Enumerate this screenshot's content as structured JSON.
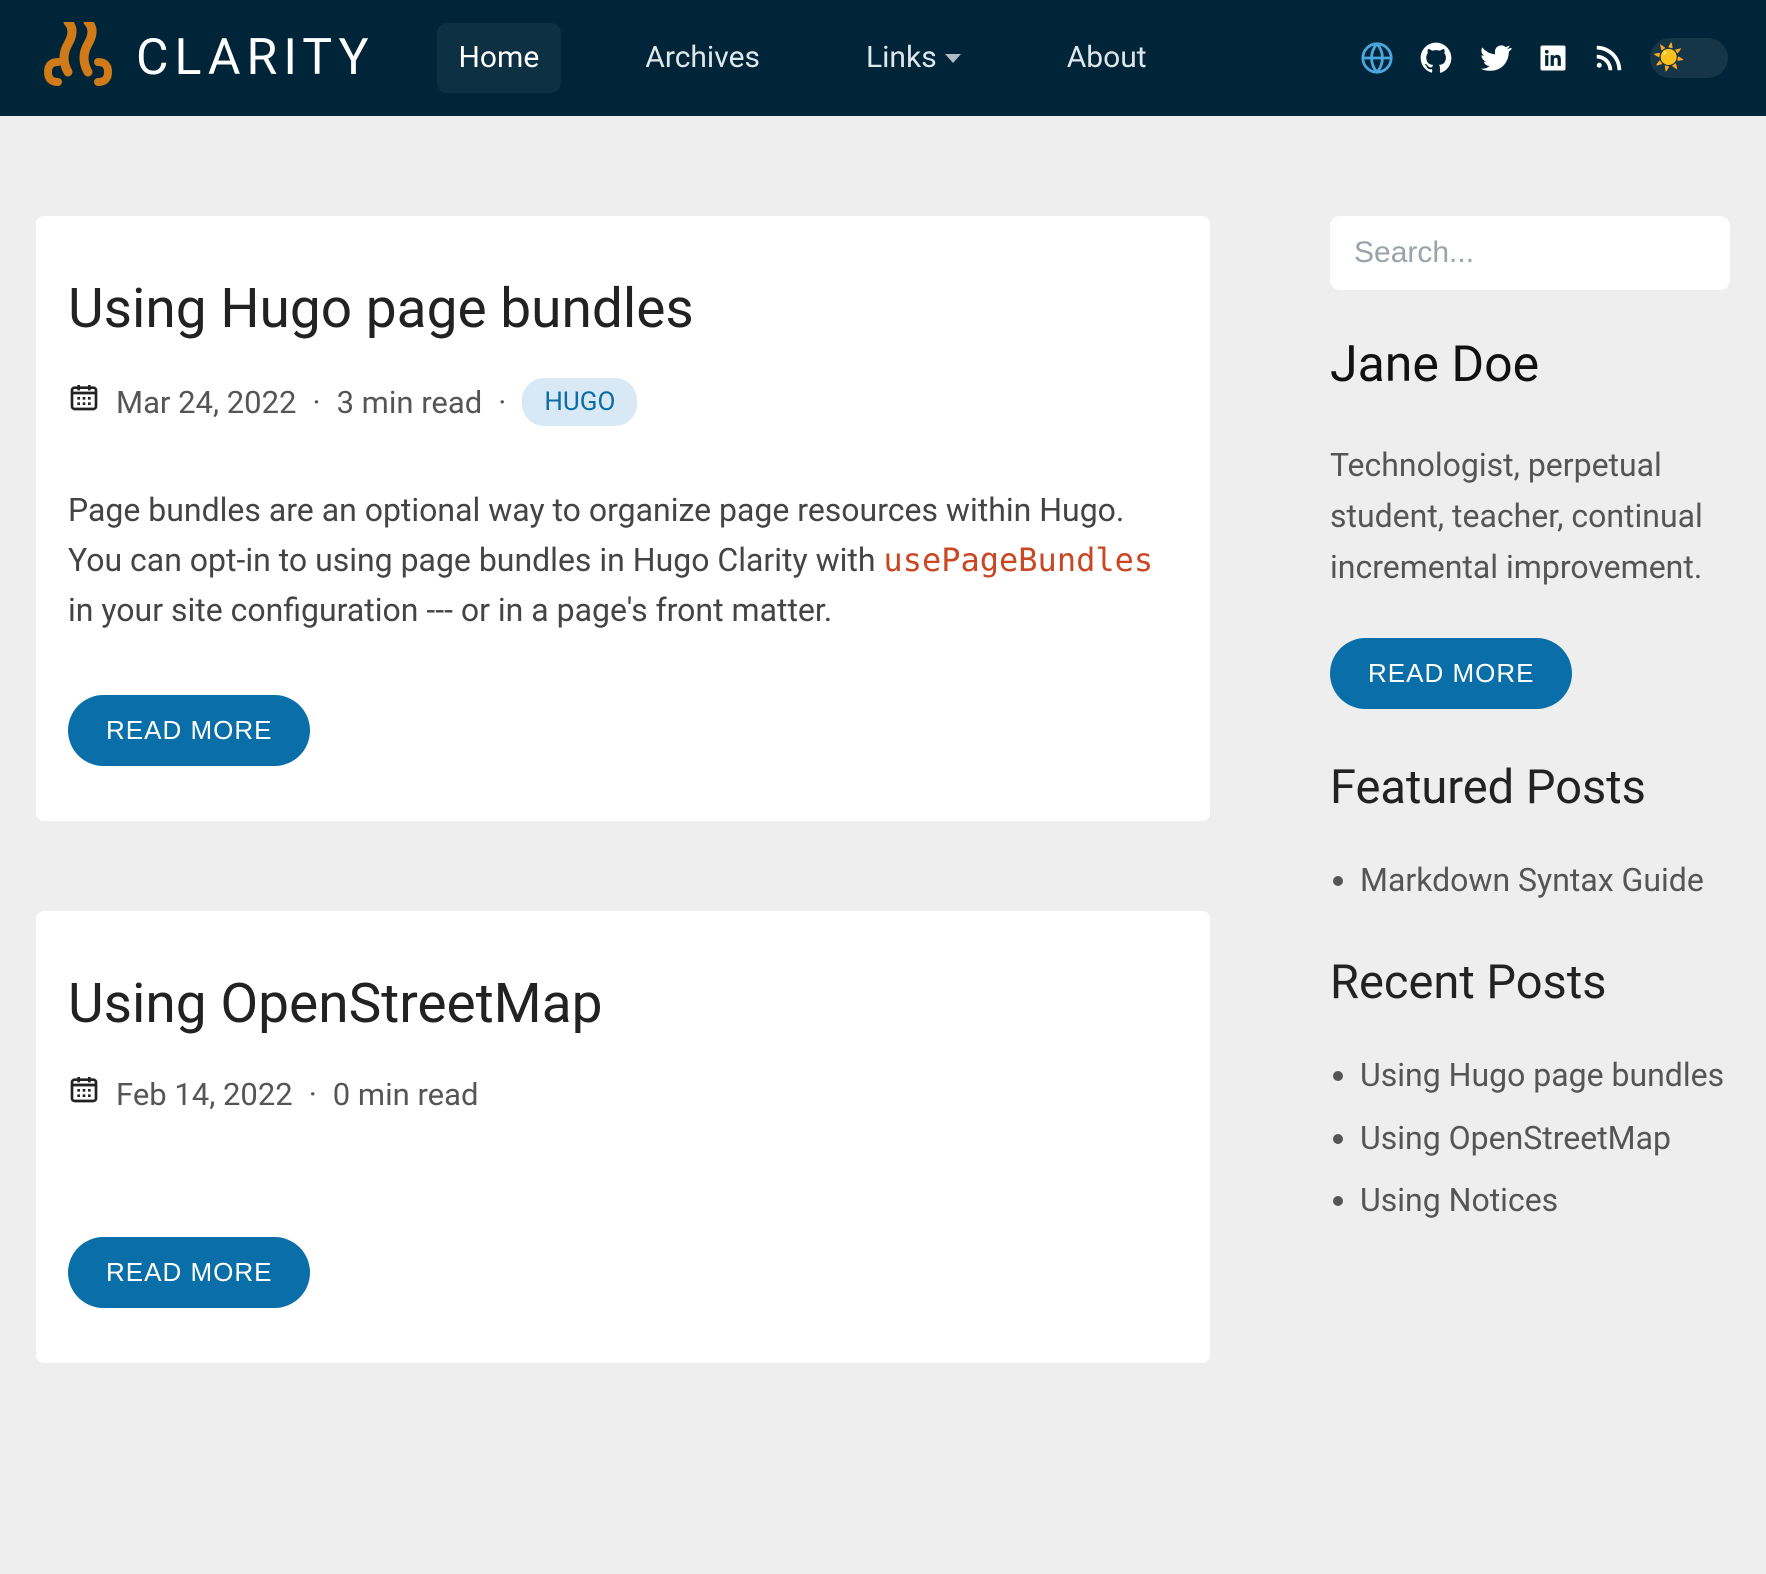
{
  "brand": {
    "name": "CLARITY"
  },
  "nav": {
    "items": [
      {
        "label": "Home",
        "active": true
      },
      {
        "label": "Archives",
        "active": false
      },
      {
        "label": "Links",
        "active": false,
        "dropdown": true
      },
      {
        "label": "About",
        "active": false
      }
    ]
  },
  "search": {
    "placeholder": "Search..."
  },
  "author": {
    "name": "Jane Doe",
    "bio": "Technologist, perpetual student, teacher, continual incremental improvement.",
    "read_more": "READ MORE"
  },
  "sidebar": {
    "featured_heading": "Featured Posts",
    "featured": [
      "Markdown Syntax Guide"
    ],
    "recent_heading": "Recent Posts",
    "recent": [
      "Using Hugo page bundles",
      "Using OpenStreetMap",
      "Using Notices"
    ]
  },
  "posts": [
    {
      "title": "Using Hugo page bundles",
      "date": "Mar 24, 2022",
      "read_time": "3 min read",
      "tags": [
        "HUGO"
      ],
      "excerpt_pre": "Page bundles are an optional way to organize page resources within Hugo. You can opt-in to using page bundles in Hugo Clarity with ",
      "excerpt_code": "usePageBundles",
      "excerpt_post": " in your site configuration --- or in a page's front matter.",
      "read_more": "READ MORE"
    },
    {
      "title": "Using OpenStreetMap",
      "date": "Feb 14, 2022",
      "read_time": "0 min read",
      "tags": [],
      "excerpt_pre": "",
      "excerpt_code": "",
      "excerpt_post": "",
      "read_more": "READ MORE"
    }
  ],
  "labels": {
    "dot": "·"
  }
}
